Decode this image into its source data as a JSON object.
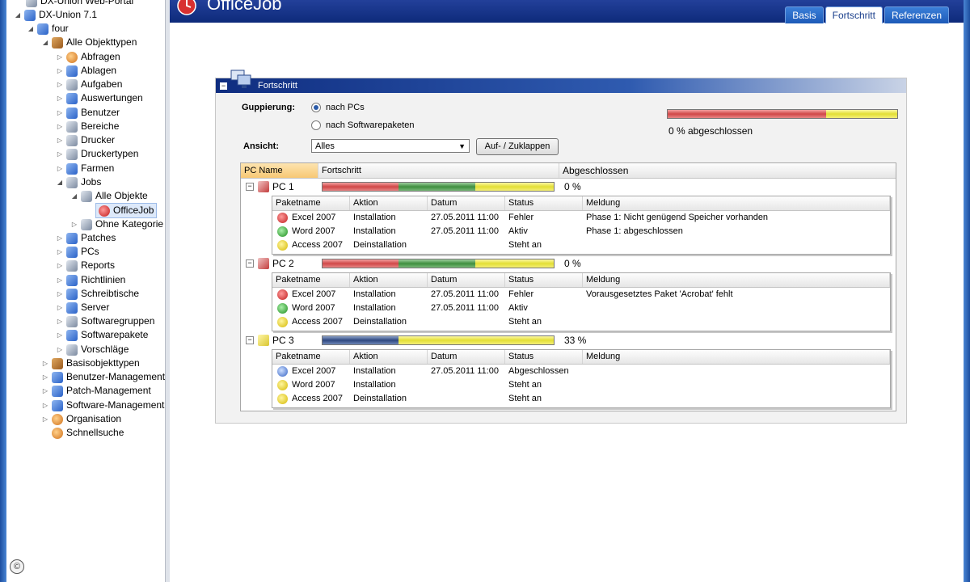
{
  "app": {
    "title": "OfficeJob"
  },
  "tabs": [
    {
      "label": "Basis",
      "active": false
    },
    {
      "label": "Fortschritt",
      "active": true
    },
    {
      "label": "Referenzen",
      "active": false
    }
  ],
  "tree": {
    "items": [
      {
        "label": "DX-Union Web-Portal",
        "icon": "portal-icon"
      },
      {
        "label": "DX-Union 7.1",
        "icon": "network-icon"
      },
      {
        "label": "four",
        "icon": "server-icon"
      },
      {
        "label": "Alle Objekttypen",
        "icon": "objects-icon"
      },
      {
        "label": "Abfragen",
        "icon": "queries-icon"
      },
      {
        "label": "Ablagen",
        "icon": "storage-icon"
      },
      {
        "label": "Aufgaben",
        "icon": "tasks-icon"
      },
      {
        "label": "Auswertungen",
        "icon": "reports-globe-icon"
      },
      {
        "label": "Benutzer",
        "icon": "user-icon"
      },
      {
        "label": "Bereiche",
        "icon": "areas-icon"
      },
      {
        "label": "Drucker",
        "icon": "printer-icon"
      },
      {
        "label": "Druckertypen",
        "icon": "printer-types-icon"
      },
      {
        "label": "Farmen",
        "icon": "farms-icon"
      },
      {
        "label": "Jobs",
        "icon": "jobs-icon"
      },
      {
        "label": "Alle Objekte",
        "icon": "all-objects-icon"
      },
      {
        "label": "OfficeJob",
        "icon": "job-icon"
      },
      {
        "label": "Ohne Kategorie",
        "icon": "uncategorized-icon"
      },
      {
        "label": "Patches",
        "icon": "patches-icon"
      },
      {
        "label": "PCs",
        "icon": "pcs-icon"
      },
      {
        "label": "Reports",
        "icon": "reports-icon"
      },
      {
        "label": "Richtlinien",
        "icon": "policies-icon"
      },
      {
        "label": "Schreibtische",
        "icon": "desktops-icon"
      },
      {
        "label": "Server",
        "icon": "server-icon"
      },
      {
        "label": "Softwaregruppen",
        "icon": "software-groups-icon"
      },
      {
        "label": "Softwarepakete",
        "icon": "software-packages-icon"
      },
      {
        "label": "Vorschläge",
        "icon": "suggestions-icon"
      },
      {
        "label": "Basisobjekttypen",
        "icon": "base-objects-icon"
      },
      {
        "label": "Benutzer-Management",
        "icon": "user-management-icon"
      },
      {
        "label": "Patch-Management",
        "icon": "patch-management-icon"
      },
      {
        "label": "Software-Management",
        "icon": "software-management-icon"
      },
      {
        "label": "Organisation",
        "icon": "organisation-icon"
      },
      {
        "label": "Schnellsuche",
        "icon": "quicksearch-icon"
      }
    ],
    "copyright": "©"
  },
  "panel": {
    "title": "Fortschritt",
    "grouping_label": "Guppierung:",
    "grouping_options": [
      {
        "label": "nach PCs",
        "checked": true
      },
      {
        "label": "nach Softwarepaketen",
        "checked": false
      }
    ],
    "view_label": "Ansicht:",
    "view_value": "Alles",
    "toggle_button": "Auf- / Zuklappen",
    "overall_text": "0 % abgeschlossen",
    "overall_progress": {
      "red": 0.69,
      "green": 0,
      "yellow": 0.31
    }
  },
  "grid": {
    "columns": [
      "PC Name",
      "Fortschritt",
      "Abgeschlossen"
    ],
    "sub_columns": [
      "Paketname",
      "Aktion",
      "Datum",
      "Status",
      "Meldung"
    ],
    "pcs": [
      {
        "name": "PC 1",
        "percent": "0 %",
        "progress": {
          "navy": 0,
          "red": 0.33,
          "green": 0.33,
          "yellow": 0.34
        },
        "packages": [
          {
            "name": "Excel 2007",
            "action": "Installation",
            "date": "27.05.2011 11:00",
            "status": "Fehler",
            "message": "Phase 1: Nicht genügend Speicher vorhanden"
          },
          {
            "name": "Word 2007",
            "action": "Installation",
            "date": "27.05.2011 11:00",
            "status": "Aktiv",
            "message": "Phase 1: abgeschlossen"
          },
          {
            "name": "Access 2007",
            "action": "Deinstallation",
            "date": "",
            "status": "Steht an",
            "message": ""
          }
        ]
      },
      {
        "name": "PC 2",
        "percent": "0 %",
        "progress": {
          "navy": 0,
          "red": 0.33,
          "green": 0.33,
          "yellow": 0.34
        },
        "packages": [
          {
            "name": "Excel 2007",
            "action": "Installation",
            "date": "27.05.2011 11:00",
            "status": "Fehler",
            "message": "Vorausgesetztes Paket 'Acrobat' fehlt"
          },
          {
            "name": "Word 2007",
            "action": "Installation",
            "date": "27.05.2011 11:00",
            "status": "Aktiv",
            "message": ""
          },
          {
            "name": "Access 2007",
            "action": "Deinstallation",
            "date": "",
            "status": "Steht an",
            "message": ""
          }
        ]
      },
      {
        "name": "PC 3",
        "percent": "33 %",
        "progress": {
          "navy": 0.33,
          "red": 0,
          "green": 0,
          "yellow": 0.67
        },
        "packages": [
          {
            "name": "Excel 2007",
            "action": "Installation",
            "date": "27.05.2011 11:00",
            "status": "Abgeschlossen",
            "message": ""
          },
          {
            "name": "Word 2007",
            "action": "Installation",
            "date": "",
            "status": "Steht an",
            "message": ""
          },
          {
            "name": "Access 2007",
            "action": "Deinstallation",
            "date": "",
            "status": "Steht an",
            "message": ""
          }
        ]
      }
    ]
  }
}
